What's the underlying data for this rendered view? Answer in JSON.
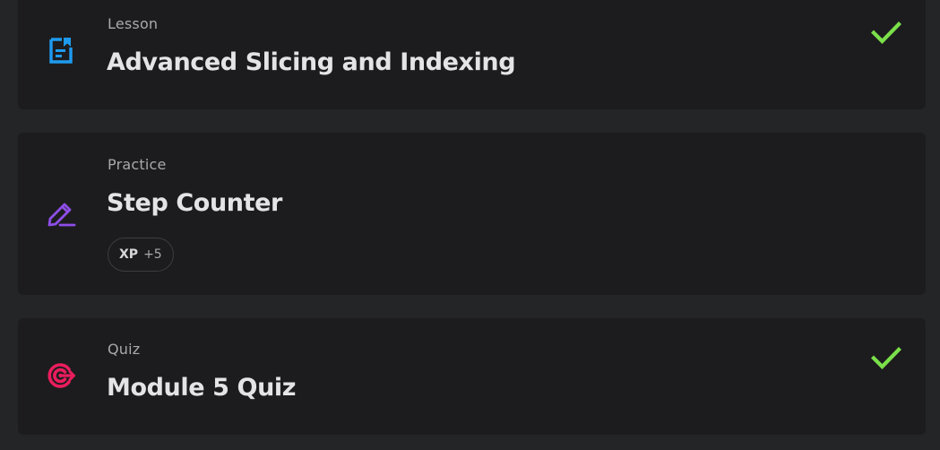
{
  "items": [
    {
      "kind": "Lesson",
      "title": "Advanced Slicing and Indexing",
      "icon": "lesson-document-icon",
      "icon_color": "#1e9bf0",
      "completed": true
    },
    {
      "kind": "Practice",
      "title": "Step Counter",
      "icon": "practice-pencil-icon",
      "icon_color": "#8e4ee8",
      "completed": false,
      "xp": {
        "label": "XP",
        "value": "+5"
      }
    },
    {
      "kind": "Quiz",
      "title": "Module 5 Quiz",
      "icon": "quiz-target-icon",
      "icon_color": "#ea1d5d",
      "completed": true
    }
  ],
  "colors": {
    "check": "#7be04a",
    "background": "#242526",
    "card": "#1c1c1e"
  }
}
